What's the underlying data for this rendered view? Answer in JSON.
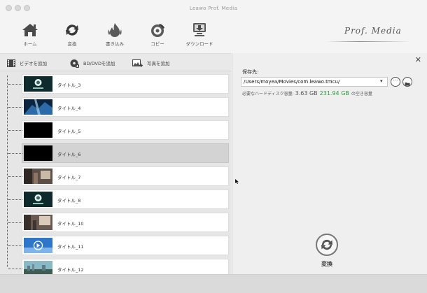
{
  "window": {
    "title": "Leawo Prof. Media"
  },
  "toolbar": {
    "items": [
      {
        "label": "ホーム",
        "icon": "home-icon"
      },
      {
        "label": "変換",
        "icon": "convert-icon"
      },
      {
        "label": "書き込み",
        "icon": "burn-icon"
      },
      {
        "label": "コピー",
        "icon": "copy-disc-icon"
      },
      {
        "label": "ダウンロード",
        "icon": "download-icon"
      }
    ],
    "logo": "Prof. Media"
  },
  "add_bar": {
    "add_video": "ビデオを追加",
    "add_bd_dvd": "BD/DVDを追加",
    "add_photo": "写真を追加"
  },
  "titles": [
    {
      "name": "タイトル_3",
      "thumb": "logo"
    },
    {
      "name": "タイトル_4",
      "thumb": "blue"
    },
    {
      "name": "タイトル_5",
      "thumb": "black"
    },
    {
      "name": "タイトル_6",
      "thumb": "black",
      "selected": true
    },
    {
      "name": "タイトル_7",
      "thumb": "street"
    },
    {
      "name": "タイトル_8",
      "thumb": "logo"
    },
    {
      "name": "タイトル_10",
      "thumb": "street2"
    },
    {
      "name": "タイトル_11",
      "thumb": "play"
    },
    {
      "name": "タイトル_12",
      "thumb": "city"
    }
  ],
  "output": {
    "save_label": "保存先:",
    "path": "/Users/moyea/Movies/com.leawo.tmcu/",
    "more_button": "···",
    "disk_required_label": "必要なハードディスク容量:",
    "disk_required_value": "3.63 GB",
    "disk_free_value": "231.94 GB",
    "disk_free_label": "の空き容量",
    "convert_label": "変換"
  },
  "colors": {
    "free_space": "#2a9a3a",
    "selected_row": "#d3d3d3"
  }
}
